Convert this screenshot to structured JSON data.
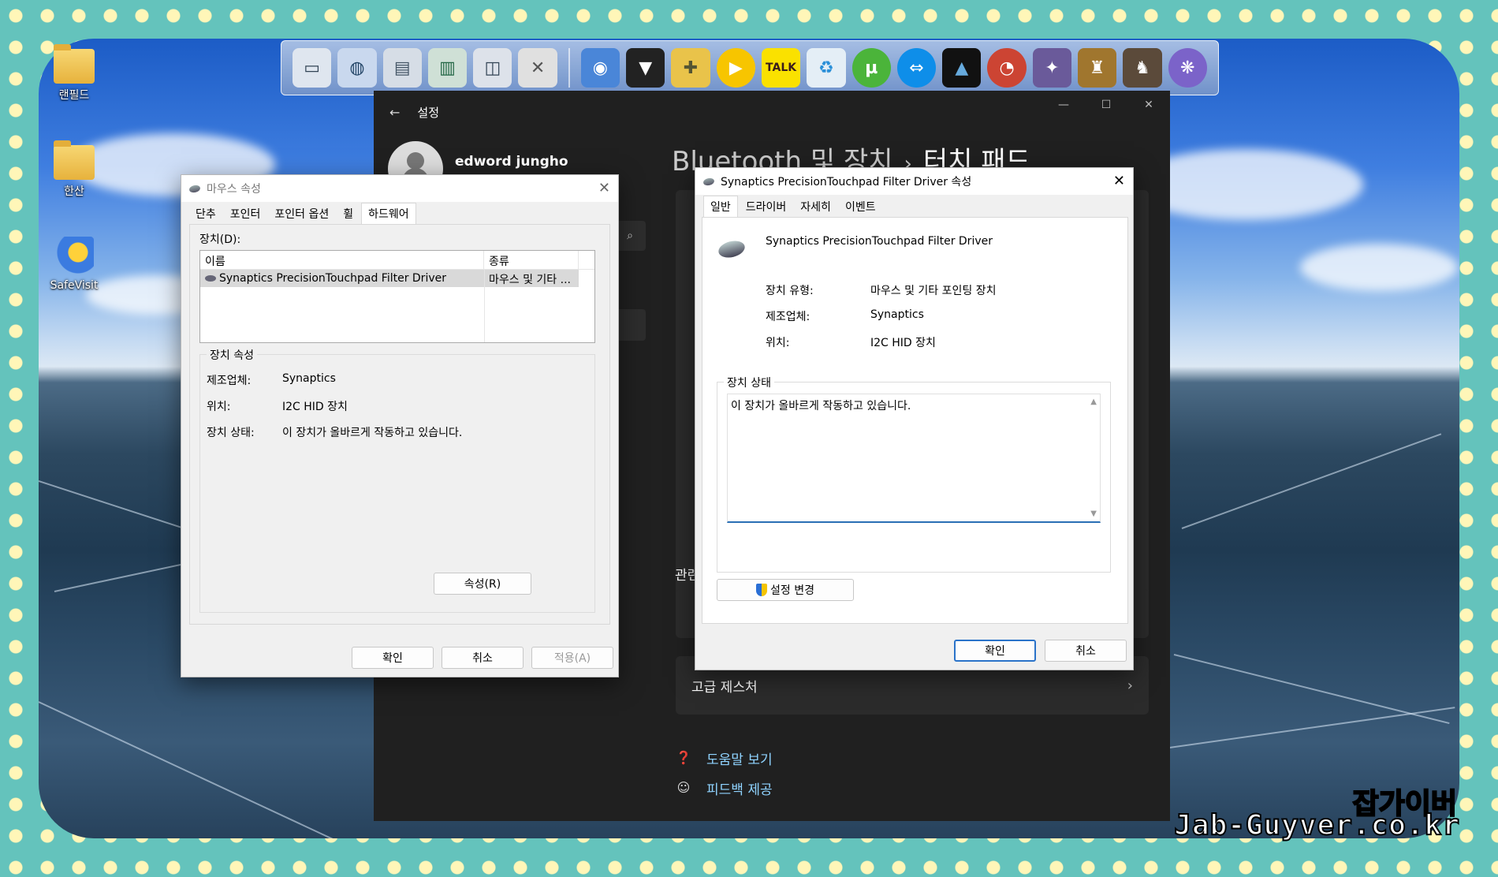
{
  "desktop_icons": [
    {
      "label": "랜필드",
      "icon": "folder-icon"
    },
    {
      "label": "한산",
      "icon": "folder-icon"
    },
    {
      "label": "SafeVisit",
      "icon": "shield-shortcut-icon"
    }
  ],
  "dock": {
    "items": [
      "monitor-icon",
      "globe-icon",
      "document-icon",
      "folder-network-icon",
      "disk-icon",
      "tools-icon",
      "earth-icon",
      "tshirt-icon",
      "hammer-wrench-icon",
      "play-icon",
      "kakaotalk-icon",
      "recycle-icon",
      "utorrent-icon",
      "teamviewer-icon",
      "triangle-app-icon",
      "gauge-icon",
      "game-icon-1",
      "game-icon-2",
      "game-icon-3",
      "tree-icon"
    ],
    "kakaotalk_label": "TALK"
  },
  "settings": {
    "title": "설정",
    "username": "edword jungho",
    "breadcrumb_parent": "Bluetooth 및 장치",
    "breadcrumb_sep": "›",
    "breadcrumb_current": "터치 패드",
    "related_heading": "관련",
    "advanced_gestures": "고급 제스처",
    "help_link": "도움말 보기",
    "feedback_link": "피드백 제공"
  },
  "mouse_dialog": {
    "title": "마우스 속성",
    "tabs": [
      "단추",
      "포인터",
      "포인터 옵션",
      "휠",
      "하드웨어"
    ],
    "selected_tab": "하드웨어",
    "devices_label": "장치(D):",
    "col_name": "이름",
    "col_type": "종류",
    "device_name": "Synaptics PrecisionTouchpad Filter Driver",
    "device_type": "마우스 및 기타 ...",
    "props_group": "장치 속성",
    "manufacturer_label": "제조업체:",
    "manufacturer": "Synaptics",
    "location_label": "위치:",
    "location": "I2C HID 장치",
    "status_label": "장치 상태:",
    "status": "이 장치가 올바르게 작동하고 있습니다.",
    "properties_btn": "속성(R)",
    "ok": "확인",
    "cancel": "취소",
    "apply": "적용(A)"
  },
  "driver_dialog": {
    "title": "Synaptics PrecisionTouchpad Filter Driver 속성",
    "tabs": [
      "일반",
      "드라이버",
      "자세히",
      "이벤트"
    ],
    "selected_tab": "일반",
    "device_name": "Synaptics PrecisionTouchpad Filter Driver",
    "type_label": "장치 유형:",
    "type": "마우스 및 기타 포인팅 장치",
    "manufacturer_label": "제조업체:",
    "manufacturer": "Synaptics",
    "location_label": "위치:",
    "location": "I2C HID 장치",
    "status_group": "장치 상태",
    "status_text": "이 장치가 올바르게 작동하고 있습니다.",
    "change_settings": "설정 변경",
    "ok": "확인",
    "cancel": "취소"
  },
  "watermark": {
    "brand": "잡가이버",
    "site": "Jab-Guyver.co.kr"
  }
}
